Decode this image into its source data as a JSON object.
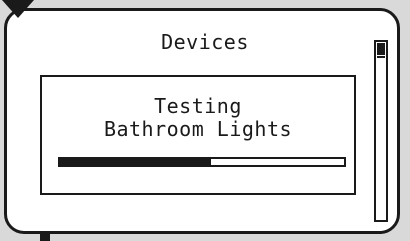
{
  "screen": {
    "title": "Devices"
  },
  "dialog": {
    "line1": "Testing",
    "line2": "Bathroom Lights",
    "progress": 0.53
  },
  "icons": {
    "header": "down-arrow-icon",
    "footer": "square-marker-icon"
  },
  "colors": {
    "foreground": "#1a1a1a",
    "background": "#ffffff",
    "frame_backdrop": "#d9d9d9"
  }
}
